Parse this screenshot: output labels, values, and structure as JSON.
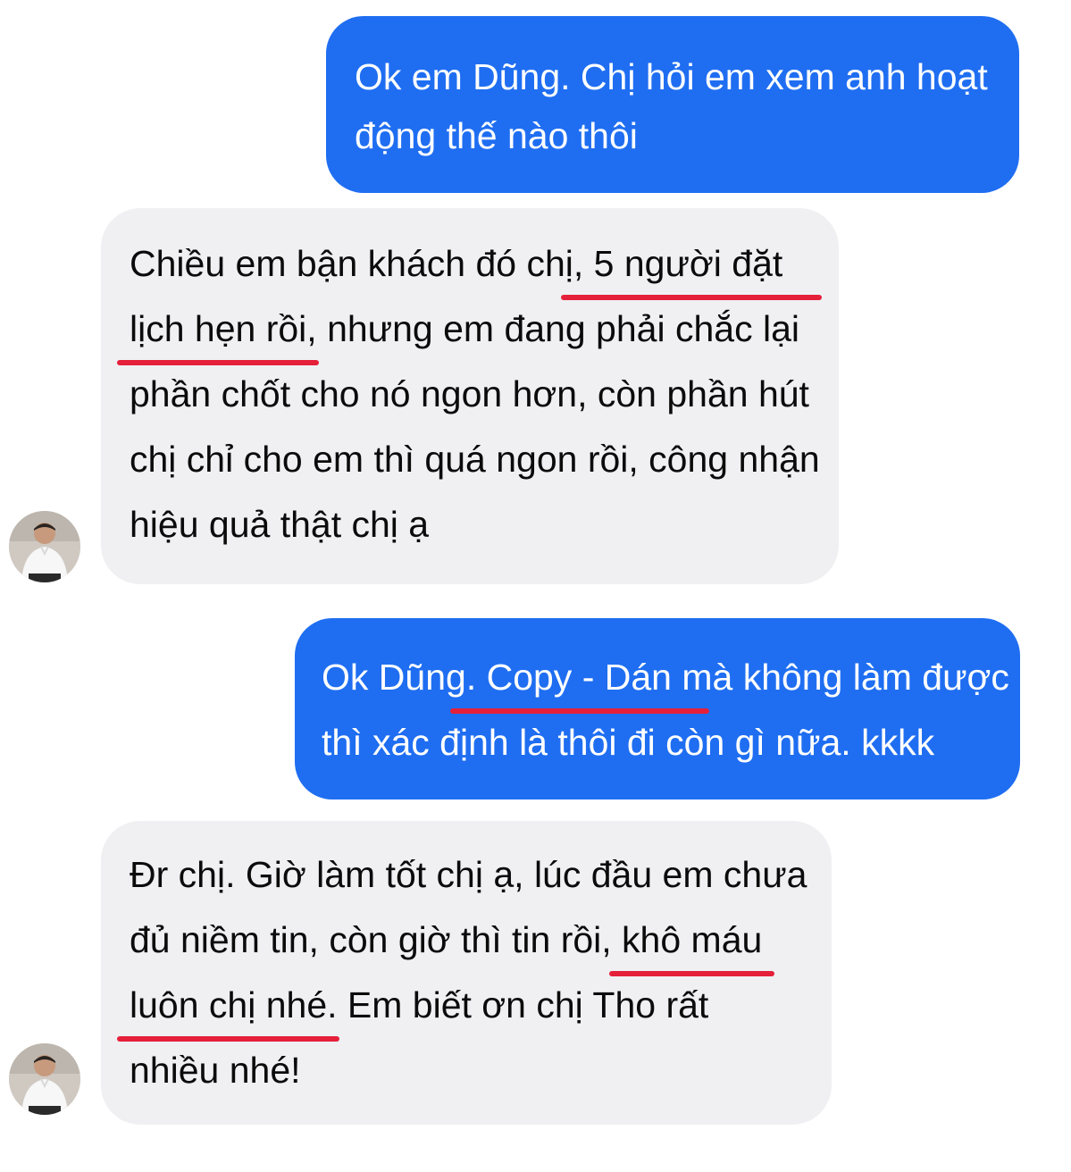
{
  "messages": [
    {
      "sender": "me",
      "lines": [
        "Ok em Dũng. Chị hỏi em xem anh hoạt",
        "động thế nào thôi"
      ]
    },
    {
      "sender": "contact",
      "line1_pre": "Chiều em bận khách đó chị",
      "line1_ul": ", 5 người đặt",
      "line2_ul": "lịch hẹn rồi",
      "line2_post": ", nhưng em đang phải chắc lại",
      "line3": "phần chốt cho nó ngon hơn, còn phần hút",
      "line4": "chị chỉ cho em thì quá ngon rồi, công nhận",
      "line5": "hiệu quả thật chị ạ"
    },
    {
      "sender": "me",
      "line1_pre": "Ok Dũng",
      "line1_ul": ". Copy - Dán",
      "line1_post": " mà không làm được",
      "line2": "thì xác định là thôi đi còn gì nữa. kkkk"
    },
    {
      "sender": "contact",
      "line1": "Đr chị. Giờ làm tốt chị ạ, lúc đầu em chưa",
      "line2_pre": "đủ niềm tin, còn giờ thì tin rồi, ",
      "line2_ul": "khô máu",
      "line3_ul": "luôn chị nhé",
      "line3_post": ". Em biết ơn chị Tho rất",
      "line4": "nhiều nhé!"
    }
  ],
  "colors": {
    "outgoing_bubble": "#1f6ef2",
    "incoming_bubble": "#f0f0f3",
    "underline": "#e5203a"
  }
}
